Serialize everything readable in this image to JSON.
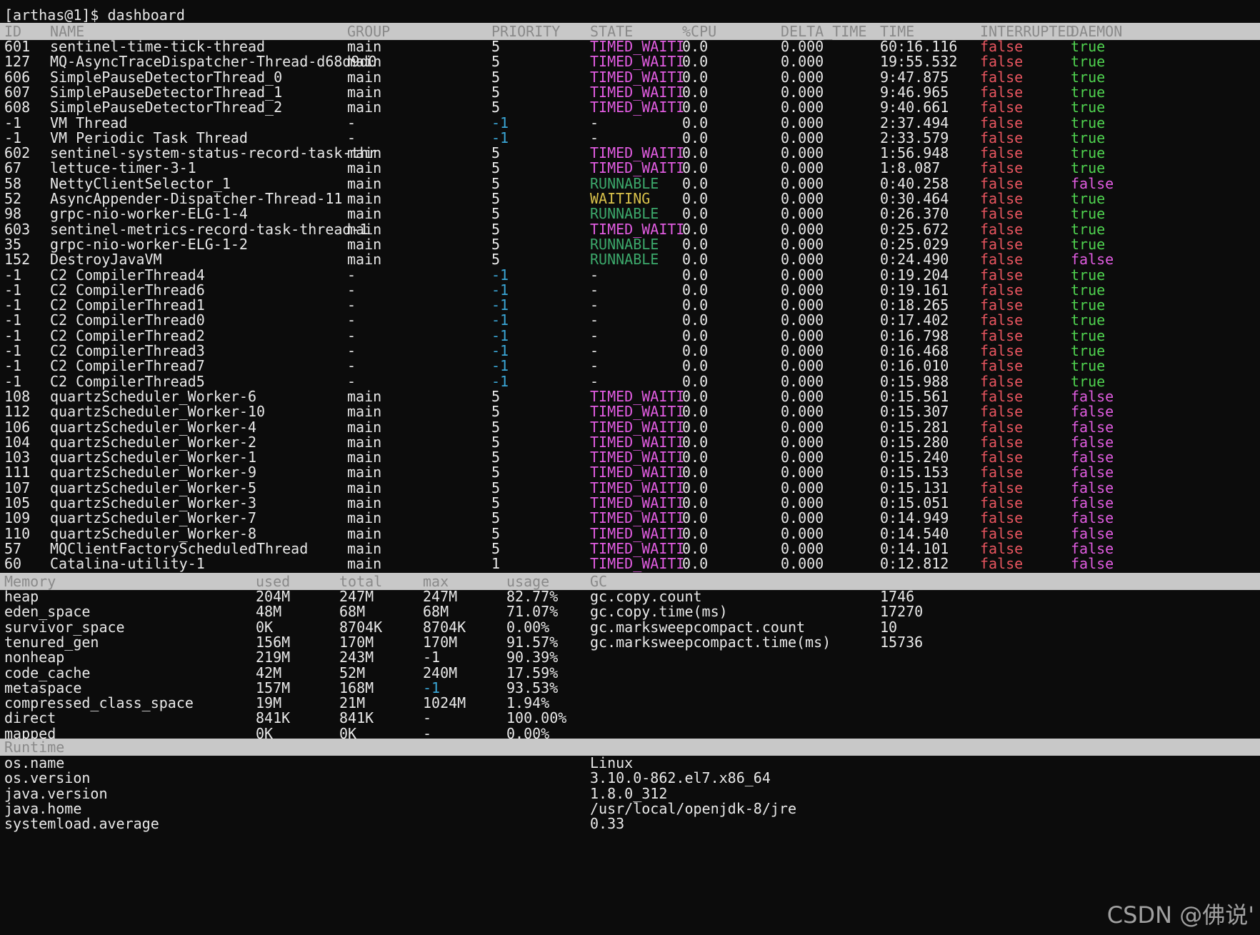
{
  "prompt": "[arthas@1]$ dashboard",
  "threads": {
    "headers": [
      "ID",
      "NAME",
      "GROUP",
      "PRIORITY",
      "STATE",
      "%CPU",
      "DELTA_TIME",
      "TIME",
      "INTERRUPTED",
      "DAEMON"
    ],
    "rows": [
      [
        "601",
        "sentinel-time-tick-thread",
        "main",
        "5",
        "TIMED_WAITI",
        "0.0",
        "0.000",
        "60:16.116",
        "false",
        "true"
      ],
      [
        "127",
        "MQ-AsyncTraceDispatcher-Thread-d68d9d0",
        "main",
        "5",
        "TIMED_WAITI",
        "0.0",
        "0.000",
        "19:55.532",
        "false",
        "true"
      ],
      [
        "606",
        "SimplePauseDetectorThread_0",
        "main",
        "5",
        "TIMED_WAITI",
        "0.0",
        "0.000",
        "9:47.875",
        "false",
        "true"
      ],
      [
        "607",
        "SimplePauseDetectorThread_1",
        "main",
        "5",
        "TIMED_WAITI",
        "0.0",
        "0.000",
        "9:46.965",
        "false",
        "true"
      ],
      [
        "608",
        "SimplePauseDetectorThread_2",
        "main",
        "5",
        "TIMED_WAITI",
        "0.0",
        "0.000",
        "9:40.661",
        "false",
        "true"
      ],
      [
        "-1",
        "VM Thread",
        "-",
        "-1",
        "-",
        "0.0",
        "0.000",
        "2:37.494",
        "false",
        "true"
      ],
      [
        "-1",
        "VM Periodic Task Thread",
        "-",
        "-1",
        "-",
        "0.0",
        "0.000",
        "2:33.579",
        "false",
        "true"
      ],
      [
        "602",
        "sentinel-system-status-record-task-thr",
        "main",
        "5",
        "TIMED_WAITI",
        "0.0",
        "0.000",
        "1:56.948",
        "false",
        "true"
      ],
      [
        "67",
        "lettuce-timer-3-1",
        "main",
        "5",
        "TIMED_WAITI",
        "0.0",
        "0.000",
        "1:8.087",
        "false",
        "true"
      ],
      [
        "58",
        "NettyClientSelector_1",
        "main",
        "5",
        "RUNNABLE",
        "0.0",
        "0.000",
        "0:40.258",
        "false",
        "false"
      ],
      [
        "52",
        "AsyncAppender-Dispatcher-Thread-11",
        "main",
        "5",
        "WAITING",
        "0.0",
        "0.000",
        "0:30.464",
        "false",
        "true"
      ],
      [
        "98",
        "grpc-nio-worker-ELG-1-4",
        "main",
        "5",
        "RUNNABLE",
        "0.0",
        "0.000",
        "0:26.370",
        "false",
        "true"
      ],
      [
        "603",
        "sentinel-metrics-record-task-thread-1",
        "main",
        "5",
        "TIMED_WAITI",
        "0.0",
        "0.000",
        "0:25.672",
        "false",
        "true"
      ],
      [
        "35",
        "grpc-nio-worker-ELG-1-2",
        "main",
        "5",
        "RUNNABLE",
        "0.0",
        "0.000",
        "0:25.029",
        "false",
        "true"
      ],
      [
        "152",
        "DestroyJavaVM",
        "main",
        "5",
        "RUNNABLE",
        "0.0",
        "0.000",
        "0:24.490",
        "false",
        "false"
      ],
      [
        "-1",
        "C2 CompilerThread4",
        "-",
        "-1",
        "-",
        "0.0",
        "0.000",
        "0:19.204",
        "false",
        "true"
      ],
      [
        "-1",
        "C2 CompilerThread6",
        "-",
        "-1",
        "-",
        "0.0",
        "0.000",
        "0:19.161",
        "false",
        "true"
      ],
      [
        "-1",
        "C2 CompilerThread1",
        "-",
        "-1",
        "-",
        "0.0",
        "0.000",
        "0:18.265",
        "false",
        "true"
      ],
      [
        "-1",
        "C2 CompilerThread0",
        "-",
        "-1",
        "-",
        "0.0",
        "0.000",
        "0:17.402",
        "false",
        "true"
      ],
      [
        "-1",
        "C2 CompilerThread2",
        "-",
        "-1",
        "-",
        "0.0",
        "0.000",
        "0:16.798",
        "false",
        "true"
      ],
      [
        "-1",
        "C2 CompilerThread3",
        "-",
        "-1",
        "-",
        "0.0",
        "0.000",
        "0:16.468",
        "false",
        "true"
      ],
      [
        "-1",
        "C2 CompilerThread7",
        "-",
        "-1",
        "-",
        "0.0",
        "0.000",
        "0:16.010",
        "false",
        "true"
      ],
      [
        "-1",
        "C2 CompilerThread5",
        "-",
        "-1",
        "-",
        "0.0",
        "0.000",
        "0:15.988",
        "false",
        "true"
      ],
      [
        "108",
        "quartzScheduler_Worker-6",
        "main",
        "5",
        "TIMED_WAITI",
        "0.0",
        "0.000",
        "0:15.561",
        "false",
        "false"
      ],
      [
        "112",
        "quartzScheduler_Worker-10",
        "main",
        "5",
        "TIMED_WAITI",
        "0.0",
        "0.000",
        "0:15.307",
        "false",
        "false"
      ],
      [
        "106",
        "quartzScheduler_Worker-4",
        "main",
        "5",
        "TIMED_WAITI",
        "0.0",
        "0.000",
        "0:15.281",
        "false",
        "false"
      ],
      [
        "104",
        "quartzScheduler_Worker-2",
        "main",
        "5",
        "TIMED_WAITI",
        "0.0",
        "0.000",
        "0:15.280",
        "false",
        "false"
      ],
      [
        "103",
        "quartzScheduler_Worker-1",
        "main",
        "5",
        "TIMED_WAITI",
        "0.0",
        "0.000",
        "0:15.240",
        "false",
        "false"
      ],
      [
        "111",
        "quartzScheduler_Worker-9",
        "main",
        "5",
        "TIMED_WAITI",
        "0.0",
        "0.000",
        "0:15.153",
        "false",
        "false"
      ],
      [
        "107",
        "quartzScheduler_Worker-5",
        "main",
        "5",
        "TIMED_WAITI",
        "0.0",
        "0.000",
        "0:15.131",
        "false",
        "false"
      ],
      [
        "105",
        "quartzScheduler_Worker-3",
        "main",
        "5",
        "TIMED_WAITI",
        "0.0",
        "0.000",
        "0:15.051",
        "false",
        "false"
      ],
      [
        "109",
        "quartzScheduler_Worker-7",
        "main",
        "5",
        "TIMED_WAITI",
        "0.0",
        "0.000",
        "0:14.949",
        "false",
        "false"
      ],
      [
        "110",
        "quartzScheduler_Worker-8",
        "main",
        "5",
        "TIMED_WAITI",
        "0.0",
        "0.000",
        "0:14.540",
        "false",
        "false"
      ],
      [
        "57",
        "MQClientFactoryScheduledThread",
        "main",
        "5",
        "TIMED_WAITI",
        "0.0",
        "0.000",
        "0:14.101",
        "false",
        "false"
      ],
      [
        "60",
        "Catalina-utility-1",
        "main",
        "1",
        "TIMED_WAITI",
        "0.0",
        "0.000",
        "0:12.812",
        "false",
        "false"
      ]
    ]
  },
  "memory": {
    "headers": [
      "Memory",
      "used",
      "total",
      "max",
      "usage",
      "GC"
    ],
    "rows": [
      [
        "heap",
        "204M",
        "247M",
        "247M",
        "82.77%",
        "gc.copy.count",
        "1746"
      ],
      [
        "eden_space",
        "48M",
        "68M",
        "68M",
        "71.07%",
        "gc.copy.time(ms)",
        "17270"
      ],
      [
        "survivor_space",
        "0K",
        "8704K",
        "8704K",
        "0.00%",
        "gc.marksweepcompact.count",
        "10"
      ],
      [
        "tenured_gen",
        "156M",
        "170M",
        "170M",
        "91.57%",
        "gc.marksweepcompact.time(ms)",
        "15736"
      ],
      [
        "nonheap",
        "219M",
        "243M",
        "-1",
        "90.39%",
        "",
        ""
      ],
      [
        "code_cache",
        "42M",
        "52M",
        "240M",
        "17.59%",
        "",
        ""
      ],
      [
        "metaspace",
        "157M",
        "168M",
        "-1",
        "93.53%",
        "",
        ""
      ],
      [
        "compressed_class_space",
        "19M",
        "21M",
        "1024M",
        "1.94%",
        "",
        ""
      ],
      [
        "direct",
        "841K",
        "841K",
        "-",
        "100.00%",
        "",
        ""
      ],
      [
        "mapped",
        "0K",
        "0K",
        "-",
        "0.00%",
        "",
        ""
      ]
    ]
  },
  "runtime": {
    "header": "Runtime",
    "rows": [
      [
        "os.name",
        "Linux"
      ],
      [
        "os.version",
        "3.10.0-862.el7.x86_64"
      ],
      [
        "java.version",
        "1.8.0_312"
      ],
      [
        "java.home",
        "/usr/local/openjdk-8/jre"
      ],
      [
        "systemload.average",
        "0.33"
      ]
    ]
  },
  "watermark": "CSDN @佛说'",
  "colors": {
    "timed_waiting": "#e05ce0",
    "runnable": "#3ca86b",
    "waiting": "#d8c04a",
    "negative_priority": "#3aa6d6",
    "interrupted_false": "#e8555f",
    "daemon_true": "#4fd24f",
    "daemon_false": "#e05ce0",
    "header_bg": "#c8c8c8",
    "background": "#0c0c0c"
  }
}
